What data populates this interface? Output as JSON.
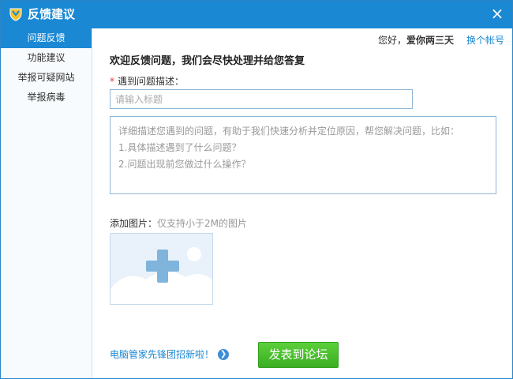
{
  "titlebar": {
    "title": "反馈建议",
    "close_label": "×"
  },
  "sidebar": {
    "items": [
      {
        "label": "问题反馈",
        "active": true
      },
      {
        "label": "功能建议",
        "active": false
      },
      {
        "label": "举报可疑网站",
        "active": false
      },
      {
        "label": "举报病毒",
        "active": false
      }
    ]
  },
  "topbar": {
    "greeting": "您好，",
    "username": "爱你两三天",
    "switch_account": "换个帐号"
  },
  "form": {
    "heading": "欢迎反馈问题，我们会尽快处理并给您答复",
    "required_mark": "*",
    "problem_label": "遇到问题描述：",
    "title_placeholder": "请输入标题",
    "desc_lines": [
      "详细描述您遇到的问题，有助于我们快速分析并定位原因，帮您解决问题，比如：",
      "1.具体描述遇到了什么问题？",
      "2.问题出现前您做过什么操作？"
    ],
    "add_image_label": "添加图片：",
    "add_image_hint": "仅支持小于2M的图片"
  },
  "footer": {
    "recruit_link": "电脑管家先锋团招新啦！",
    "post_button": "发表到论坛"
  },
  "colors": {
    "accent": "#1b88d4",
    "button_green": "#3aae22"
  }
}
